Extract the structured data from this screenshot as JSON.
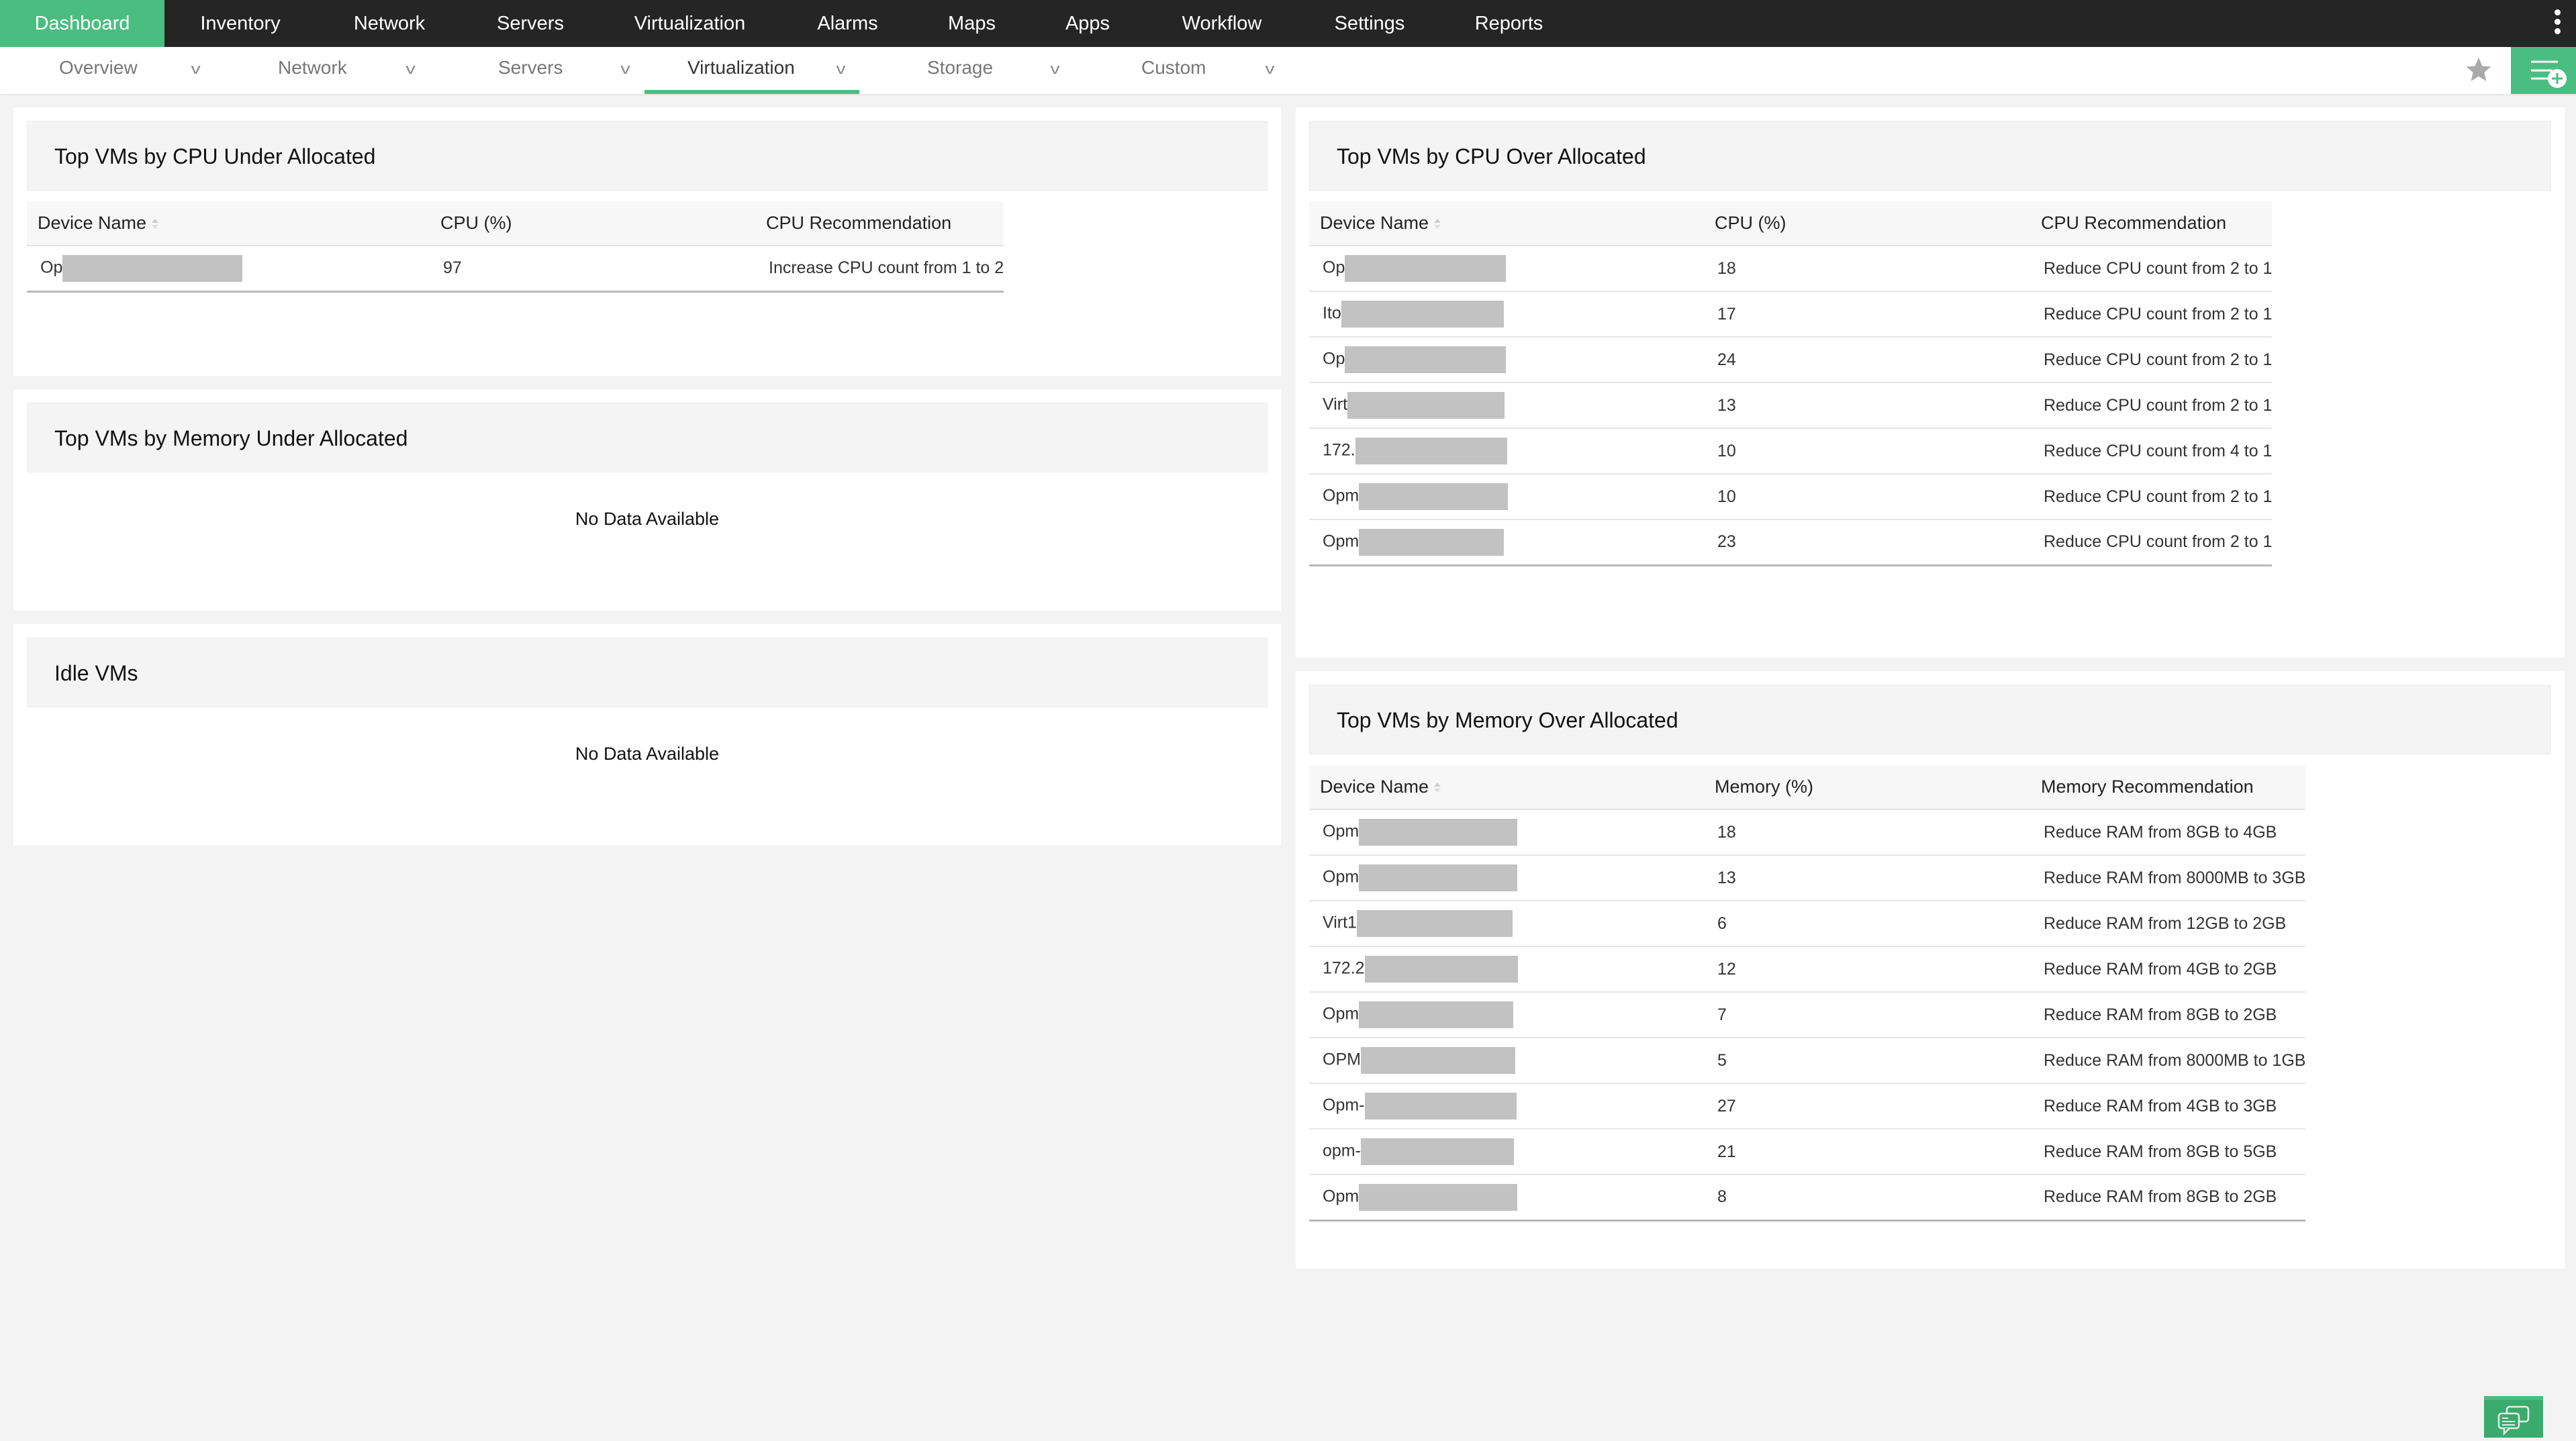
{
  "topnav": {
    "items": [
      {
        "label": "Dashboard",
        "active": true
      },
      {
        "label": "Inventory"
      },
      {
        "label": "Network"
      },
      {
        "label": "Servers"
      },
      {
        "label": "Virtualization"
      },
      {
        "label": "Alarms"
      },
      {
        "label": "Maps"
      },
      {
        "label": "Apps"
      },
      {
        "label": "Workflow"
      },
      {
        "label": "Settings"
      },
      {
        "label": "Reports"
      }
    ],
    "more_icon": "kebab-vertical-icon"
  },
  "subnav": {
    "items": [
      {
        "label": "Overview"
      },
      {
        "label": "Network"
      },
      {
        "label": "Servers"
      },
      {
        "label": "Virtualization",
        "active": true
      },
      {
        "label": "Storage"
      },
      {
        "label": "Custom"
      }
    ],
    "favorite_icon": "star-icon",
    "add_widget_icon": "list-add-icon"
  },
  "accent_color": "#4abe80",
  "widgets": {
    "cpu_under": {
      "title": "Top VMs by CPU Under Allocated",
      "columns": [
        "Device Name",
        "CPU (%)",
        "CPU Recommendation"
      ],
      "rows": [
        {
          "name": "Op",
          "value": "97",
          "rec": "Increase CPU count from 1 to 2"
        }
      ]
    },
    "mem_under": {
      "title": "Top VMs by Memory Under Allocated",
      "empty_text": "No Data Available"
    },
    "idle": {
      "title": "Idle VMs",
      "empty_text": "No Data Available"
    },
    "cpu_over": {
      "title": "Top VMs by CPU Over Allocated",
      "columns": [
        "Device Name",
        "CPU (%)",
        "CPU Recommendation"
      ],
      "rows": [
        {
          "name": "Op",
          "value": "18",
          "rec": "Reduce CPU count from 2 to 1"
        },
        {
          "name": "Ito",
          "value": "17",
          "rec": "Reduce CPU count from 2 to 1"
        },
        {
          "name": "Op",
          "value": "24",
          "rec": "Reduce CPU count from 2 to 1"
        },
        {
          "name": "Virt",
          "value": "13",
          "rec": "Reduce CPU count from 2 to 1"
        },
        {
          "name": "172.",
          "value": "10",
          "rec": "Reduce CPU count from 4 to 1"
        },
        {
          "name": "Opm",
          "value": "10",
          "rec": "Reduce CPU count from 2 to 1"
        },
        {
          "name": "Opm",
          "value": "23",
          "rec": "Reduce CPU count from 2 to 1"
        }
      ]
    },
    "mem_over": {
      "title": "Top VMs by Memory Over Allocated",
      "columns": [
        "Device Name",
        "Memory (%)",
        "Memory Recommendation"
      ],
      "rows": [
        {
          "name": "Opm",
          "value": "18",
          "rec": "Reduce RAM from 8GB to 4GB"
        },
        {
          "name": "Opm",
          "value": "13",
          "rec": "Reduce RAM from 8000MB to 3GB"
        },
        {
          "name": "Virt1",
          "value": "6",
          "rec": "Reduce RAM from 12GB to 2GB"
        },
        {
          "name": "172.2",
          "value": "12",
          "rec": "Reduce RAM from 4GB to 2GB"
        },
        {
          "name": "Opm",
          "value": "7",
          "rec": "Reduce RAM from 8GB to 2GB"
        },
        {
          "name": "OPM",
          "value": "5",
          "rec": "Reduce RAM from 8000MB to 1GB"
        },
        {
          "name": "Opm-",
          "value": "27",
          "rec": "Reduce RAM from 4GB to 3GB"
        },
        {
          "name": "opm-",
          "value": "21",
          "rec": "Reduce RAM from 8GB to 5GB"
        },
        {
          "name": "Opm",
          "value": "8",
          "rec": "Reduce RAM from 8GB to 2GB"
        }
      ]
    }
  },
  "chat_icon": "chat-bubbles-icon"
}
